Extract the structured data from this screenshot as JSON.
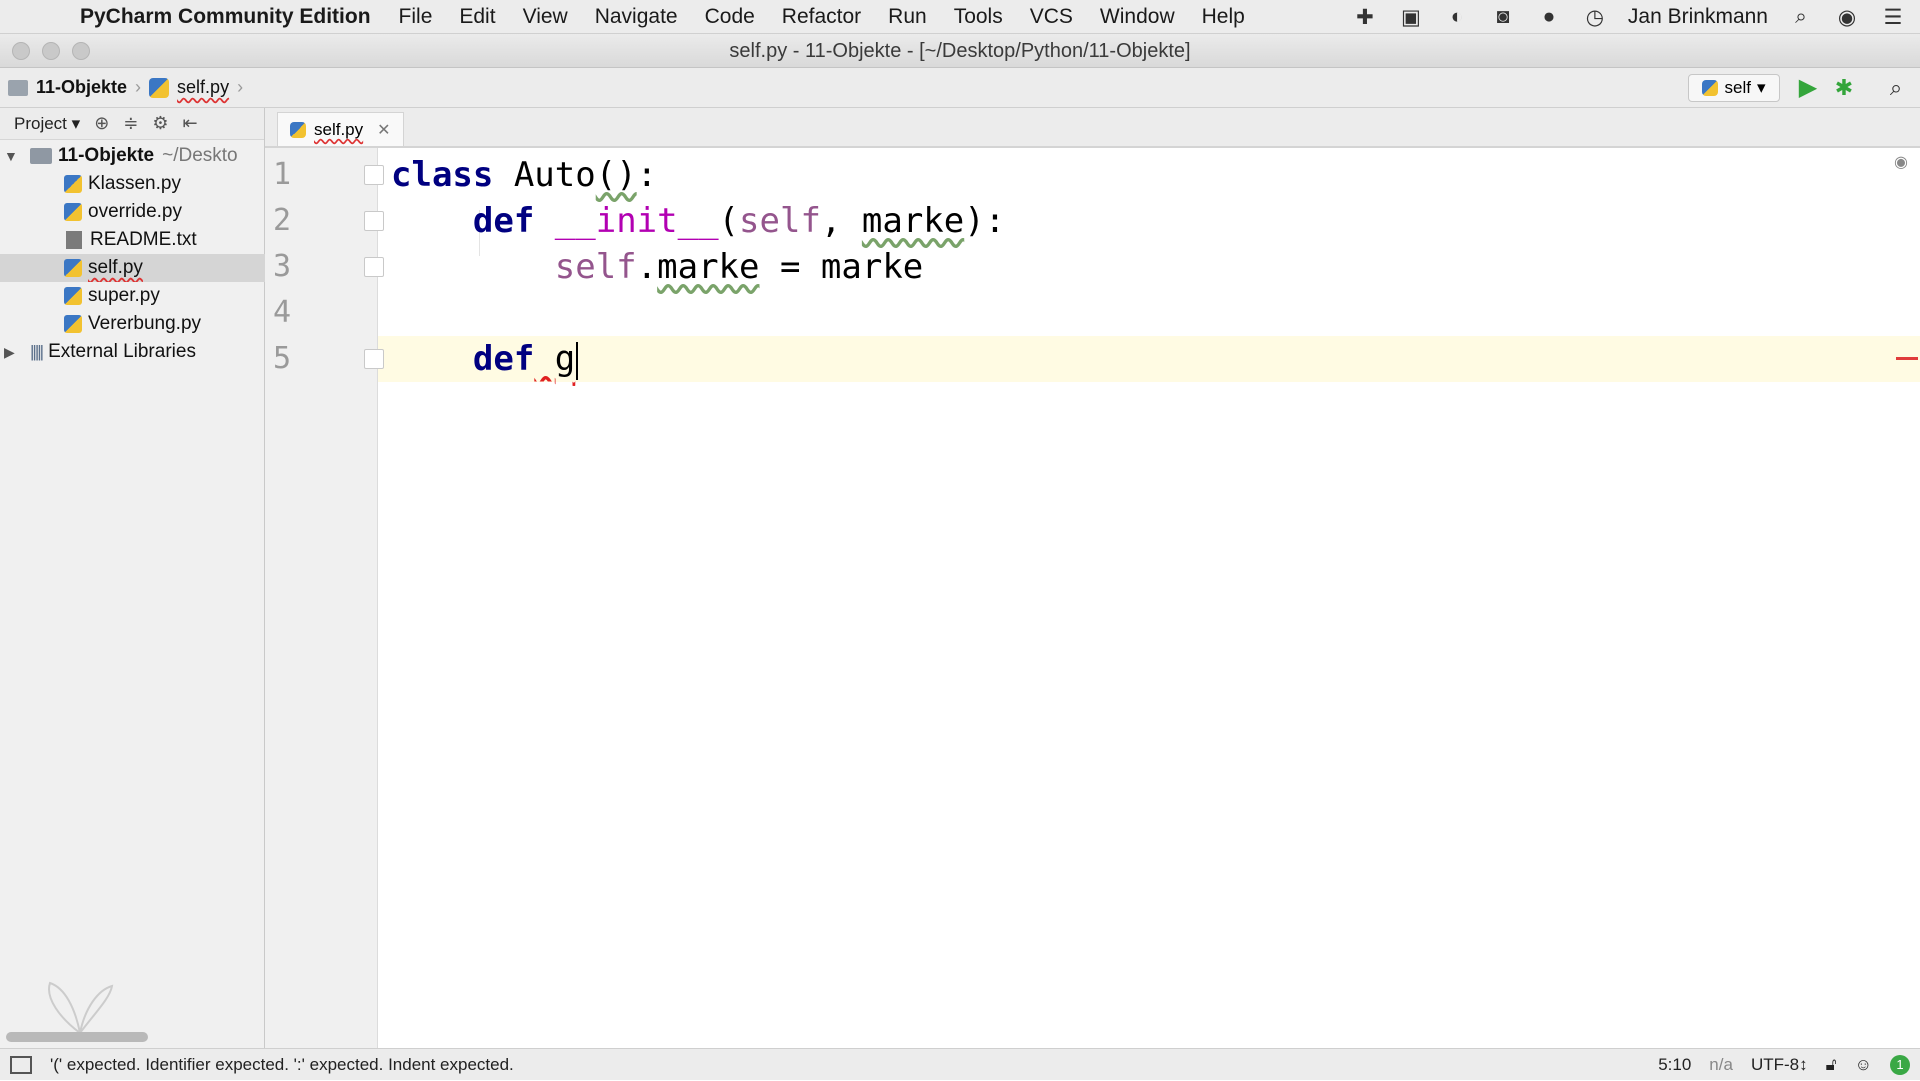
{
  "menubar": {
    "app_name": "PyCharm Community Edition",
    "menus": [
      "File",
      "Edit",
      "View",
      "Navigate",
      "Code",
      "Refactor",
      "Run",
      "Tools",
      "VCS",
      "Window",
      "Help"
    ],
    "user": "Jan Brinkmann",
    "tray_icons": [
      "plus-cross-icon",
      "briefcase-icon",
      "leaf-icon",
      "camera-icon",
      "chat-icon",
      "history-clock-icon"
    ]
  },
  "window": {
    "title": "self.py - 11-Objekte - [~/Desktop/Python/11-Objekte]"
  },
  "navbar": {
    "breadcrumbs": [
      "11-Objekte",
      "self.py"
    ],
    "run_config": "self"
  },
  "project_panel": {
    "label": "Project",
    "root": {
      "name": "11-Objekte",
      "hint": "~/Deskto"
    },
    "files": [
      {
        "name": "Klassen.py",
        "type": "py"
      },
      {
        "name": "override.py",
        "type": "py"
      },
      {
        "name": "README.txt",
        "type": "txt"
      },
      {
        "name": "self.py",
        "type": "py"
      },
      {
        "name": "super.py",
        "type": "py"
      },
      {
        "name": "Vererbung.py",
        "type": "py"
      }
    ],
    "selected_file": "self.py",
    "external": "External Libraries"
  },
  "editor": {
    "tab": "self.py",
    "line_numbers": [
      "1",
      "2",
      "3",
      "4",
      "5"
    ],
    "code": {
      "l1_kw": "class",
      "l1_name": " Auto",
      "l1_parens": "()",
      "l1_colon": ":",
      "l2_indent": "    ",
      "l2_kw": "def",
      "l2_fn": " __init__",
      "l2_open": "(",
      "l2_self": "self",
      "l2_sep": ", ",
      "l2_param": "marke",
      "l2_close": "):",
      "l3_indent": "        ",
      "l3_self": "self",
      "l3_dot": ".",
      "l3_attr": "marke",
      "l3_rest": " = marke",
      "l5_indent": "    ",
      "l5_kw": "def",
      "l5_space": " ",
      "l5_name": "g"
    },
    "cursor": "5:10"
  },
  "statusbar": {
    "message": "'(' expected. Identifier expected. ':' expected. Indent expected.",
    "position": "5:10",
    "na": "n/a",
    "encoding": "UTF-8↕",
    "notifications": "1"
  }
}
